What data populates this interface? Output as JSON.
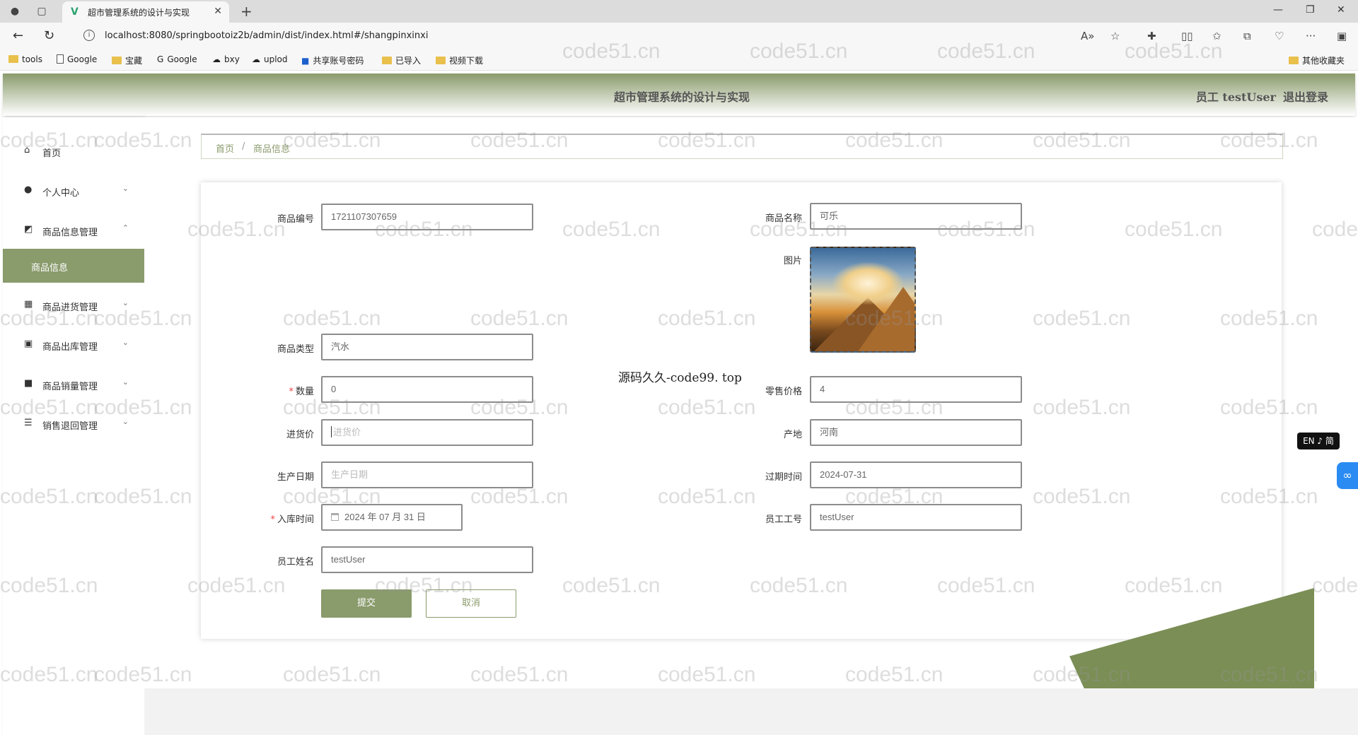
{
  "browser": {
    "tab_title": "超市管理系统的设计与实现",
    "url": "localhost:8080/springbootoiz2b/admin/dist/index.html#/shangpinxinxi",
    "bookmarks": [
      "tools",
      "Google",
      "宝藏",
      "Google",
      "bxy",
      "uplod",
      "共享账号密码",
      "已导入",
      "视频下载"
    ],
    "other_bookmarks": "其他收藏夹"
  },
  "header": {
    "title": "超市管理系统的设计与实现",
    "user_label": "员工 testUser",
    "logout": "退出登录"
  },
  "sidebar": {
    "items": [
      {
        "label": "首页",
        "icon": "home-icon"
      },
      {
        "label": "个人中心",
        "icon": "user-icon"
      },
      {
        "label": "商品信息管理",
        "icon": "chart-icon"
      },
      {
        "label": "商品信息",
        "icon": ""
      },
      {
        "label": "商品进货管理",
        "icon": "grid-icon"
      },
      {
        "label": "商品出库管理",
        "icon": "clipboard-icon"
      },
      {
        "label": "商品销量管理",
        "icon": "video-icon"
      },
      {
        "label": "销售退回管理",
        "icon": "list-icon"
      }
    ]
  },
  "breadcrumb": {
    "home": "首页",
    "sep": "/",
    "current": "商品信息"
  },
  "form": {
    "code_label": "商品编号",
    "code_value": "1721107307659",
    "name_label": "商品名称",
    "name_value": "可乐",
    "image_label": "图片",
    "type_label": "商品类型",
    "type_value": "汽水",
    "qty_label": "数量",
    "qty_value": "0",
    "retail_label": "零售价格",
    "retail_value": "4",
    "purchase_label": "进货价",
    "purchase_placeholder": "进货价",
    "origin_label": "产地",
    "origin_value": "河南",
    "prod_date_label": "生产日期",
    "prod_date_placeholder": "生产日期",
    "expire_label": "过期时间",
    "expire_value": "2024-07-31",
    "in_time_label": "入库时间",
    "in_time_value": "2024 年 07 月 31 日",
    "emp_no_label": "员工工号",
    "emp_no_value": "testUser",
    "emp_name_label": "员工姓名",
    "emp_name_value": "testUser",
    "required_mark": "*",
    "submit": "提交",
    "cancel": "取消"
  },
  "overlay_text": "源码久久-code99. top",
  "lang_badge": "EN ♪ 简",
  "watermark": "code51.cn",
  "colors": {
    "accent": "#8a9b6c",
    "shape": "#7b8e55"
  }
}
